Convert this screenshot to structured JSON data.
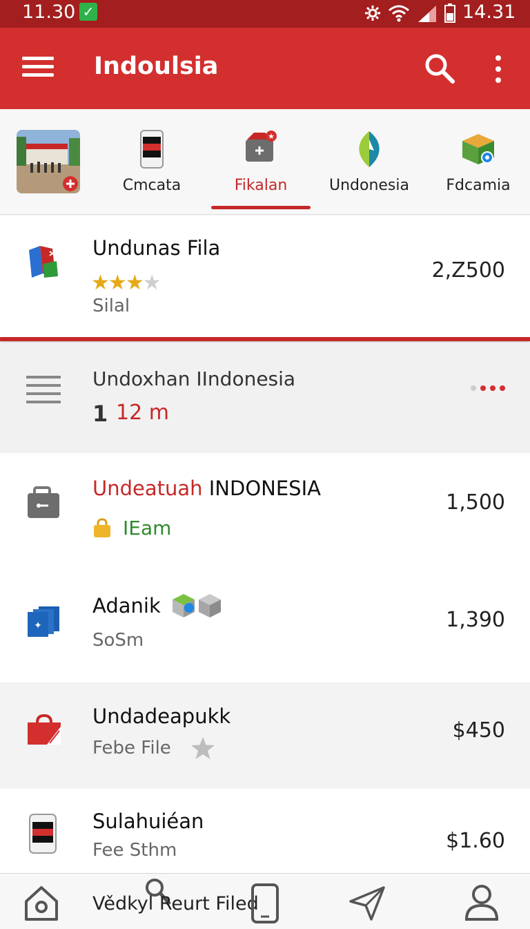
{
  "status_bar": {
    "time_left": "11.30",
    "time_right": "14.31"
  },
  "app_bar": {
    "title": "Indoulsia"
  },
  "tabs": [
    {
      "label": "Cmcata"
    },
    {
      "label": "Fikalan"
    },
    {
      "label": "Undonesia"
    },
    {
      "label": "Fdcamia"
    }
  ],
  "active_tab": "Fikalan",
  "items": [
    {
      "name": "Undunas Fila",
      "rating": 3,
      "sub": "Silal",
      "price": "2,Z500"
    },
    {
      "name": "Undoxhan IIndonesia",
      "sub_num": "1",
      "sub": "12 m"
    },
    {
      "name_accent": "Undeatuah",
      "name": "INDONESIA",
      "sub": "IEam",
      "price": "1,500"
    },
    {
      "name": "Adanik",
      "sub": "SoSm",
      "price": "1,390"
    },
    {
      "name": "Undadeapukk",
      "sub": "Febe File",
      "price": "$450"
    },
    {
      "name": "Sulahuiéan",
      "sub": "Fee Sthm",
      "price": "$1.60"
    }
  ],
  "bottom_nav": {
    "overlay_text": "Vědkyl Reurt Filed"
  },
  "colors": {
    "primary": "#d32f2f",
    "status_bar": "#a31e1e",
    "accent_text": "#c62828",
    "green_text": "#2e8b2e"
  }
}
